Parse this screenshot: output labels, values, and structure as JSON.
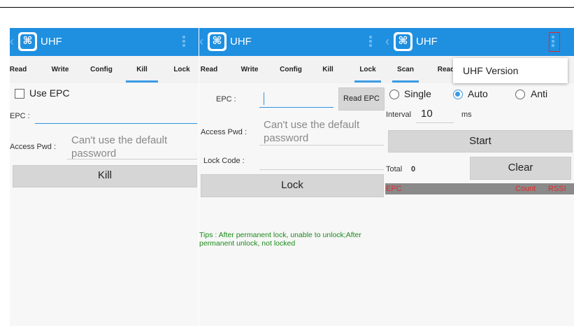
{
  "app": {
    "title": "UHF"
  },
  "panels": {
    "kill": {
      "tabs": [
        "Read",
        "Write",
        "Config",
        "Kill",
        "Lock"
      ],
      "active_tab": "Kill",
      "use_epc_label": "Use EPC",
      "epc_label": "EPC :",
      "epc_value": "",
      "access_pwd_label": "Access Pwd :",
      "access_pwd_placeholder": "Can't use the default password",
      "kill_button": "Kill"
    },
    "lock": {
      "tabs": [
        "Read",
        "Write",
        "Config",
        "Kill",
        "Lock"
      ],
      "active_tab": "Lock",
      "epc_label": "EPC :",
      "epc_value": "",
      "read_epc_button": "Read EPC",
      "access_pwd_label": "Access Pwd :",
      "access_pwd_placeholder": "Can't use the default password",
      "lock_code_label": "Lock Code :",
      "lock_code_value": "",
      "lock_button": "Lock",
      "tips": "Tips : After permanent lock, unable to unlock;After permanent unlock, not locked"
    },
    "scan": {
      "tabs": [
        "Scan",
        "Read"
      ],
      "active_tab": "Scan",
      "menu_item": "UHF Version",
      "mode_options": [
        "Single",
        "Auto",
        "Anti"
      ],
      "selected_mode": "Auto",
      "interval_label": "Interval",
      "interval_value": "10",
      "interval_unit": "ms",
      "start_button": "Start",
      "total_label": "Total",
      "total_value": "0",
      "clear_button": "Clear",
      "table_headers": [
        "EPC",
        "Count",
        "RSSI"
      ]
    }
  },
  "colors": {
    "appbar": "#1f8fe0",
    "accent": "#3a9be6",
    "tips": "#1a8a1a",
    "table_header_text": "#e02a2a"
  },
  "icons": [
    "back-chevron-icon",
    "uhf-logo-icon",
    "overflow-menu-icon"
  ]
}
